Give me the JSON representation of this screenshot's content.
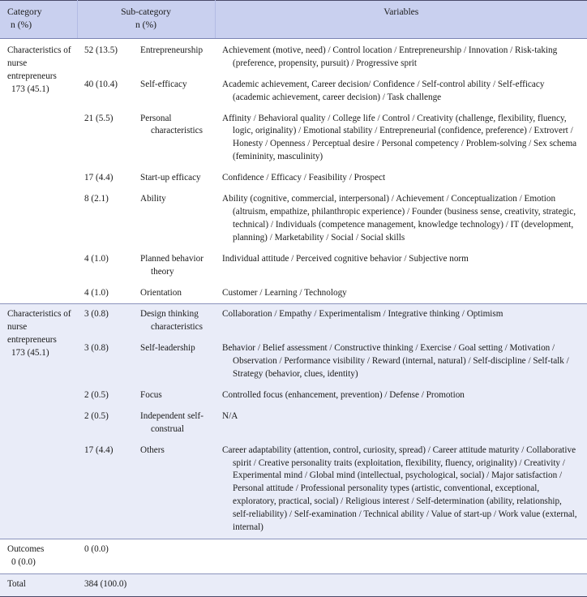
{
  "table": {
    "headers": {
      "category": {
        "line1": "Category",
        "line2": "n (%)"
      },
      "subcategory": {
        "line1": "Sub-category",
        "line2": "n (%)"
      },
      "variables": "Variables"
    },
    "sections": [
      {
        "id": "section-1",
        "shaded": false,
        "category": {
          "label": "Characteristics of nurse entrepreneurs",
          "count": "173 (45.1)"
        },
        "rows": [
          {
            "count": "52 (13.5)",
            "subcategory": "Entrepreneurship",
            "variables": "Achievement (motive, need) / Control location / Entrepreneurship / Innovation / Risk-taking (preference, propensity, pursuit) / Progressive sprit"
          },
          {
            "count": "40 (10.4)",
            "subcategory": "Self-efficacy",
            "variables": "Academic achievement, Career decision/ Confidence / Self-control ability / Self-efficacy (academic achievement, career decision) / Task challenge"
          },
          {
            "count": "21 (5.5)",
            "subcategory": "Personal characteristics",
            "variables": "Affinity / Behavioral quality / College life / Control / Creativity (challenge, flexibility, fluency, logic, originality) / Emotional stability / Entrepreneurial (confidence, preference) / Extrovert / Honesty / Openness / Perceptual desire / Personal competency / Problem-solving / Sex schema (femininity, masculinity)"
          },
          {
            "count": "17 (4.4)",
            "subcategory": "Start-up efficacy",
            "variables": "Confidence / Efficacy / Feasibility / Prospect"
          },
          {
            "count": "8 (2.1)",
            "subcategory": "Ability",
            "variables": "Ability (cognitive, commercial, interpersonal) / Achievement / Conceptualization / Emotion (altruism, empathize, philanthropic experience) / Founder (business sense, creativity, strategic, technical) / Individuals (competence management, knowledge technology) / IT (development, planning) / Marketability / Social / Social skills"
          },
          {
            "count": "4 (1.0)",
            "subcategory": "Planned behavior theory",
            "variables": "Individual attitude / Perceived cognitive behavior / Subjective norm"
          },
          {
            "count": "4 (1.0)",
            "subcategory": "Orientation",
            "variables": "Customer / Learning / Technology"
          }
        ]
      },
      {
        "id": "section-2",
        "shaded": true,
        "category": {
          "label": "Characteristics of nurse entrepreneurs",
          "count": "173 (45.1)"
        },
        "rows": [
          {
            "count": "3 (0.8)",
            "subcategory": "Design thinking characteristics",
            "variables": "Collaboration / Empathy / Experimentalism / Integrative thinking / Optimism"
          },
          {
            "count": "3 (0.8)",
            "subcategory": "Self-leadership",
            "variables": "Behavior / Belief assessment / Constructive thinking / Exercise / Goal setting / Motivation / Observation / Performance visibility / Reward (internal, natural) / Self-discipline / Self-talk / Strategy (behavior, clues, identity)"
          },
          {
            "count": "2 (0.5)",
            "subcategory": "Focus",
            "variables": "Controlled focus (enhancement, prevention) / Defense / Promotion"
          },
          {
            "count": "2 (0.5)",
            "subcategory": "Independent self-construal",
            "variables": "N/A"
          },
          {
            "count": "17 (4.4)",
            "subcategory": "Others",
            "variables": "Career adaptability (attention, control, curiosity, spread) / Career attitude maturity / Collaborative spirit / Creative personality traits (exploitation, flexibility, fluency, originality) / Creativity / Experimental mind / Global mind (intellectual, psychological, social) / Major satisfaction / Personal attitude / Professional personality types (artistic, conventional, exceptional, exploratory, practical, social) / Religious interest / Self-determination (ability, relationship, self-reliability) / Self-examination / Technical ability / Value of start-up / Work value (external, internal)"
          }
        ]
      }
    ],
    "outcomes": {
      "label": "Outcomes",
      "count": "0 (0.0)",
      "sub_count": "0 (0.0)",
      "subcategory": "",
      "variables": ""
    },
    "total": {
      "label": "Total",
      "count": "384 (100.0)",
      "subcategory": "",
      "variables": ""
    }
  },
  "colors": {
    "header_bg": "#c9d0ef",
    "shaded_bg": "#e9ecf8",
    "rule": "#8b93bd",
    "heavy_rule": "#4a4a6a",
    "text": "#1a1a1a"
  }
}
